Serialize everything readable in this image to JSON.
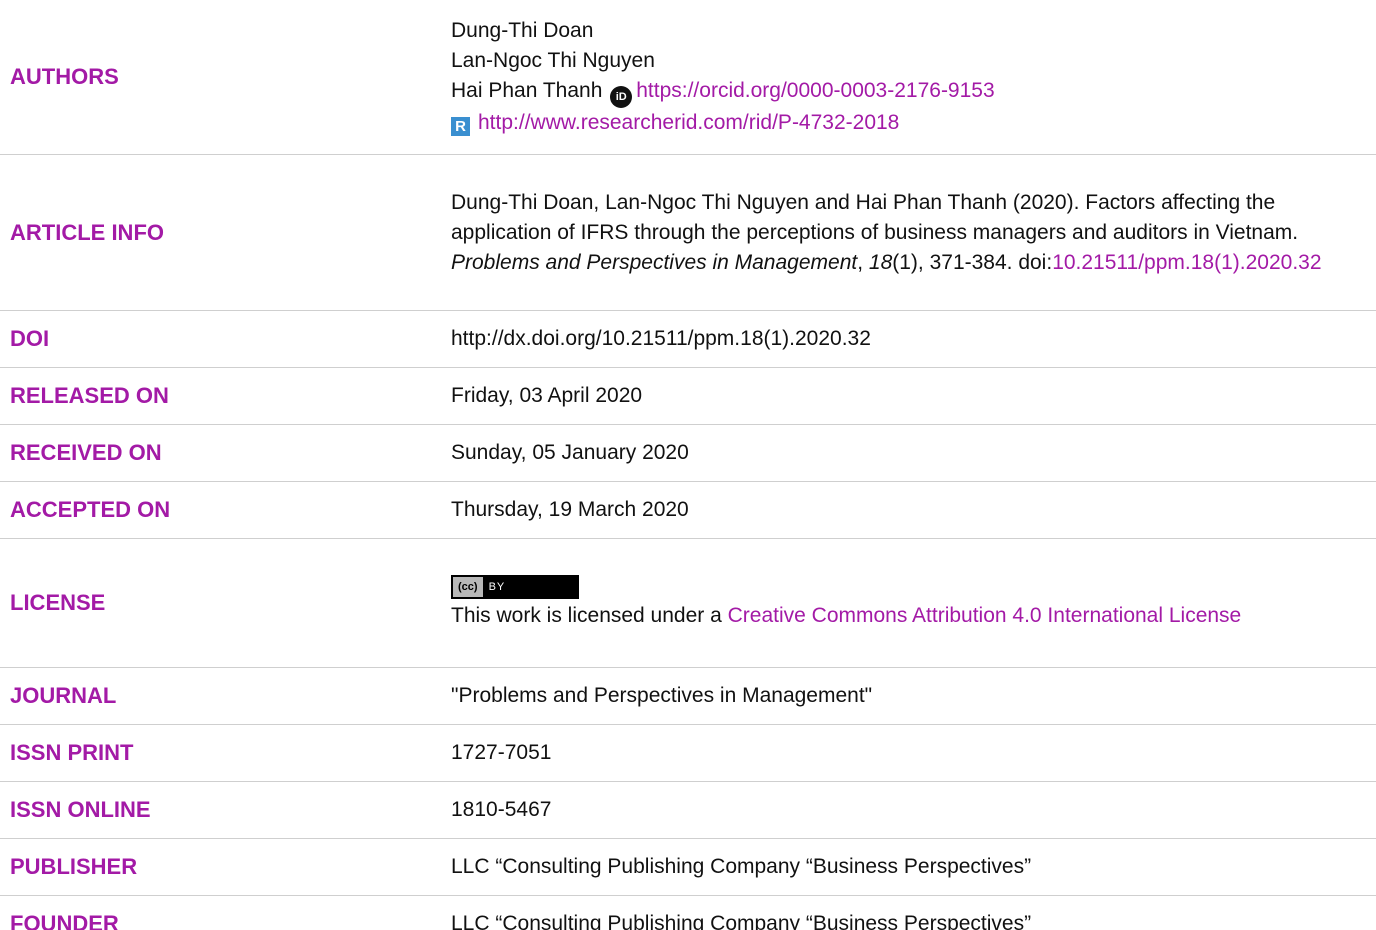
{
  "rows": {
    "authors": {
      "label": "AUTHORS",
      "names": [
        "Dung-Thi Doan",
        "Lan-Ngoc Thi Nguyen",
        "Hai Phan Thanh"
      ],
      "orcid_url": "https://orcid.org/0000-0003-2176-9153",
      "researcherid_url": "http://www.researcherid.com/rid/P-4732-2018"
    },
    "article_info": {
      "label": "ARTICLE INFO",
      "citation_prefix": "Dung-Thi Doan, Lan-Ngoc Thi Nguyen and Hai Phan Thanh (2020). Factors affecting the application of IFRS through the perceptions of business managers and auditors in Vietnam. ",
      "journal_italic": "Problems and Perspectives in Management",
      "sep1": ", ",
      "volume_italic": "18",
      "issue_pages": "(1), 371-384. doi:",
      "doi_link": "10.21511/ppm.18(1).2020.32"
    },
    "doi": {
      "label": "DOI",
      "value": "http://dx.doi.org/10.21511/ppm.18(1).2020.32"
    },
    "released_on": {
      "label": "RELEASED ON",
      "value": "Friday, 03 April 2020"
    },
    "received_on": {
      "label": "RECEIVED ON",
      "value": "Sunday, 05 January 2020"
    },
    "accepted_on": {
      "label": "ACCEPTED ON",
      "value": "Thursday, 19 March 2020"
    },
    "license": {
      "label": "LICENSE",
      "badge_cc": "(cc)",
      "badge_by": "BY",
      "text_prefix": "This work is licensed under a ",
      "link_text": "Creative Commons Attribution 4.0 International License"
    },
    "journal": {
      "label": "JOURNAL",
      "value": "\"Problems and Perspectives in Management\""
    },
    "issn_print": {
      "label": "ISSN PRINT",
      "value": "1727-7051"
    },
    "issn_online": {
      "label": "ISSN ONLINE",
      "value": "1810-5467"
    },
    "publisher": {
      "label": "PUBLISHER",
      "value": "LLC “Consulting Publishing Company “Business Perspectives”"
    },
    "founder": {
      "label": "FOUNDER",
      "value": "LLC “Consulting Publishing Company “Business Perspectives”"
    }
  },
  "icons": {
    "orcid": "orcid-icon",
    "researcherid": "researcherid-icon",
    "license_badge": "cc-by-badge-icon"
  },
  "colors": {
    "label": "#a31aa6",
    "link": "#a31aa6",
    "text": "#111111",
    "divider": "#cfcfcf"
  }
}
